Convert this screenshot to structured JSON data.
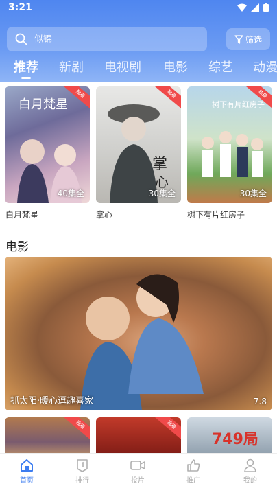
{
  "status_bar": {
    "time": "3:21"
  },
  "search": {
    "placeholder": "似锦"
  },
  "filter": {
    "label": "筛选"
  },
  "tabs": [
    {
      "label": "推荐"
    },
    {
      "label": "新剧"
    },
    {
      "label": "电视剧"
    },
    {
      "label": "电影"
    },
    {
      "label": "综艺"
    },
    {
      "label": "动漫"
    }
  ],
  "series": [
    {
      "title": "白月梵星",
      "episodes": "40集全",
      "badge": "独播"
    },
    {
      "title": "掌心",
      "episodes": "30集全",
      "badge": "独播"
    },
    {
      "title": "树下有片红房子",
      "episodes": "30集全",
      "badge": "独播"
    }
  ],
  "movie_section": {
    "title": "电影",
    "banner": {
      "caption": "抓太阳·暖心逗趣喜家",
      "score": "7.8"
    },
    "posters": [
      {
        "badge": "独播"
      },
      {
        "badge": "独播"
      },
      {
        "title_art": "749局"
      }
    ]
  },
  "bottom_nav": [
    {
      "label": "首页",
      "icon": "home-icon"
    },
    {
      "label": "排行",
      "icon": "rank-icon"
    },
    {
      "label": "投片",
      "icon": "video-icon"
    },
    {
      "label": "推广",
      "icon": "thumb-up-icon"
    },
    {
      "label": "我的",
      "icon": "user-icon"
    }
  ],
  "colors": {
    "accent": "#3d7df0",
    "header": "#5a8ef1",
    "badge": "#f04a4a"
  }
}
